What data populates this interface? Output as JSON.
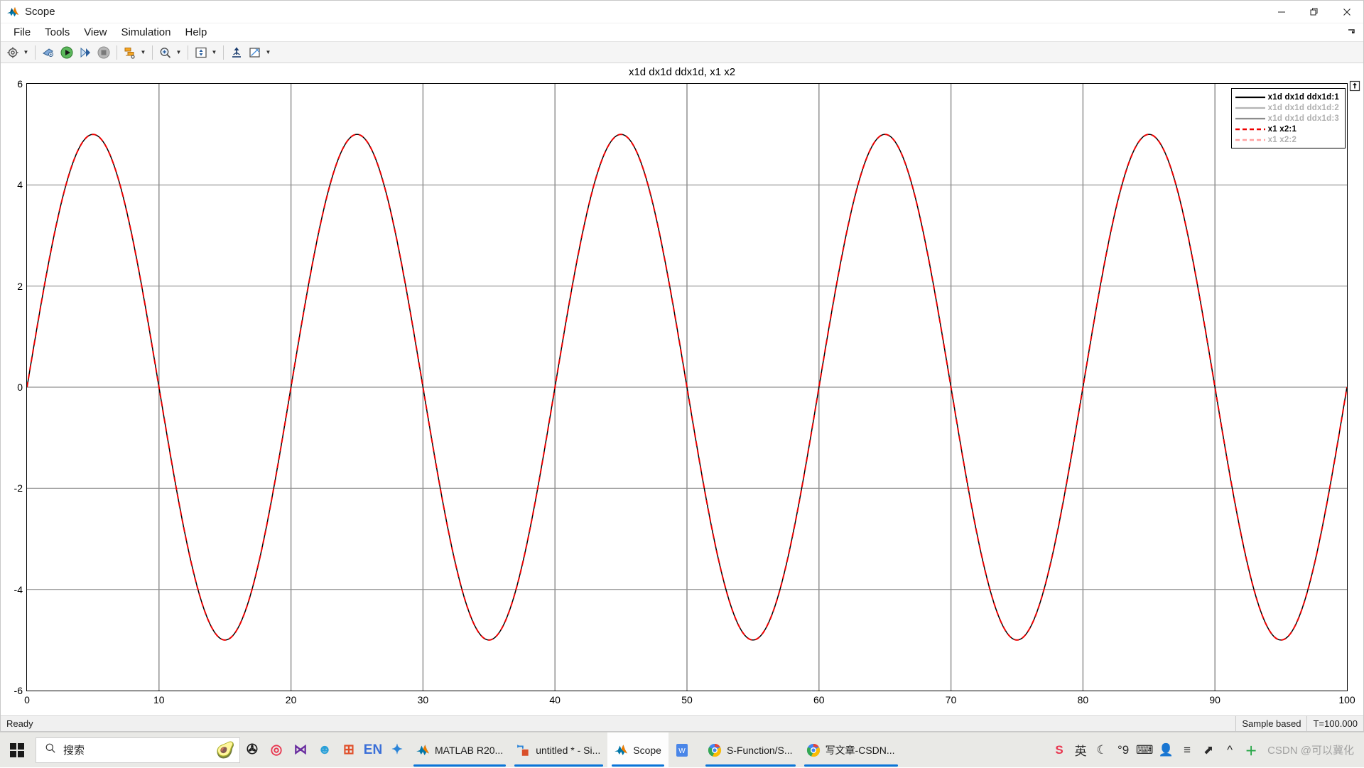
{
  "window": {
    "title": "Scope",
    "app_icon": "matlab-icon",
    "minimize_label": "Minimize",
    "restore_label": "Restore",
    "close_label": "Close"
  },
  "menu": {
    "items": [
      {
        "label": "File"
      },
      {
        "label": "Tools"
      },
      {
        "label": "View"
      },
      {
        "label": "Simulation"
      },
      {
        "label": "Help"
      }
    ],
    "overflow_icon": "menubar-overflow-icon"
  },
  "toolbar": {
    "buttons": [
      {
        "name": "configuration-properties-icon",
        "caret": true
      },
      {
        "name": "print-icon",
        "caret": false
      },
      {
        "name": "run-icon",
        "caret": false
      },
      {
        "name": "step-forward-icon",
        "caret": false
      },
      {
        "name": "stop-icon",
        "caret": false
      },
      {
        "name": "signal-selection-icon",
        "caret": true
      },
      {
        "name": "zoom-in-icon",
        "caret": true
      },
      {
        "name": "autoscale-icon",
        "caret": true
      },
      {
        "name": "highlight-signal-icon",
        "caret": false
      },
      {
        "name": "measurements-icon",
        "caret": true
      }
    ]
  },
  "plot": {
    "title": "x1d   dx1d   ddx1d, x1 x2",
    "pin_icon": "pin-icon"
  },
  "legend": {
    "entries": [
      {
        "label": "x1d   dx1d   ddx1d:1",
        "color": "#000000",
        "style": "solid",
        "faded": false
      },
      {
        "label": "x1d   dx1d   ddx1d:2",
        "color": "#b4b4b4",
        "style": "solid",
        "faded": true
      },
      {
        "label": "x1d   dx1d   ddx1d:3",
        "color": "#8c8c8c",
        "style": "solid",
        "faded": true
      },
      {
        "label": "x1 x2:1",
        "color": "#ee0000",
        "style": "dashed",
        "faded": false
      },
      {
        "label": "x1 x2:2",
        "color": "#ffa0a0",
        "style": "dashed",
        "faded": true
      }
    ]
  },
  "status": {
    "ready": "Ready",
    "frame_mode": "Sample based",
    "time": "T=100.000"
  },
  "taskbar": {
    "start_icon": "windows-start-icon",
    "search": {
      "placeholder": "搜索",
      "icon": "search-icon",
      "trailing_icon": "avocado-icon"
    },
    "pinned": [
      {
        "name": "scratch-icon",
        "glyph": "✇"
      },
      {
        "name": "netease-music-icon",
        "glyph": "◎"
      },
      {
        "name": "visual-studio-icon",
        "glyph": "⋈"
      },
      {
        "name": "app-icon-1",
        "glyph": "☻"
      },
      {
        "name": "jetbrains-icon",
        "glyph": "⊞"
      },
      {
        "name": "eudic-icon",
        "glyph": "EN"
      },
      {
        "name": "tim-icon",
        "glyph": "✦"
      }
    ],
    "windows": [
      {
        "name": "taskbar-matlab",
        "label": "MATLAB R20...",
        "icon": "matlab-icon",
        "active": false
      },
      {
        "name": "taskbar-simulink",
        "label": "untitled * - Si...",
        "icon": "simulink-icon",
        "active": false
      },
      {
        "name": "taskbar-scope",
        "label": "Scope",
        "icon": "matlab-icon",
        "active": true
      },
      {
        "name": "taskbar-wps",
        "label": "",
        "icon": "wps-icon",
        "active": false
      },
      {
        "name": "taskbar-chrome-1",
        "label": "S-Function/S...",
        "icon": "chrome-icon",
        "active": false
      },
      {
        "name": "taskbar-chrome-2",
        "label": "写文章-CSDN...",
        "icon": "chrome-icon",
        "active": false
      }
    ],
    "tray": [
      {
        "name": "sogou-ime-icon",
        "glyph": "S"
      },
      {
        "name": "ime-chinese-icon",
        "glyph": "英"
      },
      {
        "name": "moon-icon",
        "glyph": "☾"
      },
      {
        "name": "degree-icon",
        "glyph": "°9"
      },
      {
        "name": "keyboard-icon",
        "glyph": "⌨"
      },
      {
        "name": "account-icon",
        "glyph": "👤"
      },
      {
        "name": "menu-icon",
        "glyph": "≡"
      },
      {
        "name": "share-icon",
        "glyph": "⬈"
      },
      {
        "name": "show-hidden-icons-icon",
        "glyph": "^"
      },
      {
        "name": "update-icon",
        "glyph": "＋"
      }
    ],
    "watermark": "CSDN @可以冀化"
  },
  "chart_data": {
    "type": "line",
    "title": "x1d   dx1d   ddx1d, x1 x2",
    "xlabel": "",
    "ylabel": "",
    "xlim": [
      0,
      100
    ],
    "ylim": [
      -6,
      6
    ],
    "xticks": [
      0,
      10,
      20,
      30,
      40,
      50,
      60,
      70,
      80,
      90,
      100
    ],
    "yticks": [
      6,
      4,
      2,
      0,
      -2,
      -4,
      -6
    ],
    "grid": true,
    "legend_position": "top-right",
    "series": [
      {
        "name": "x1d   dx1d   ddx1d:1",
        "color": "#000000",
        "style": "solid",
        "width": 1.5,
        "waveform": "sine",
        "amplitude": 5,
        "period": 20,
        "phase": 0,
        "offset": 0
      },
      {
        "name": "x1 x2:1",
        "color": "#ee0000",
        "style": "dashed",
        "width": 2,
        "waveform": "sine",
        "amplitude": 5,
        "period": 20,
        "phase": 0,
        "offset": 0
      }
    ]
  }
}
